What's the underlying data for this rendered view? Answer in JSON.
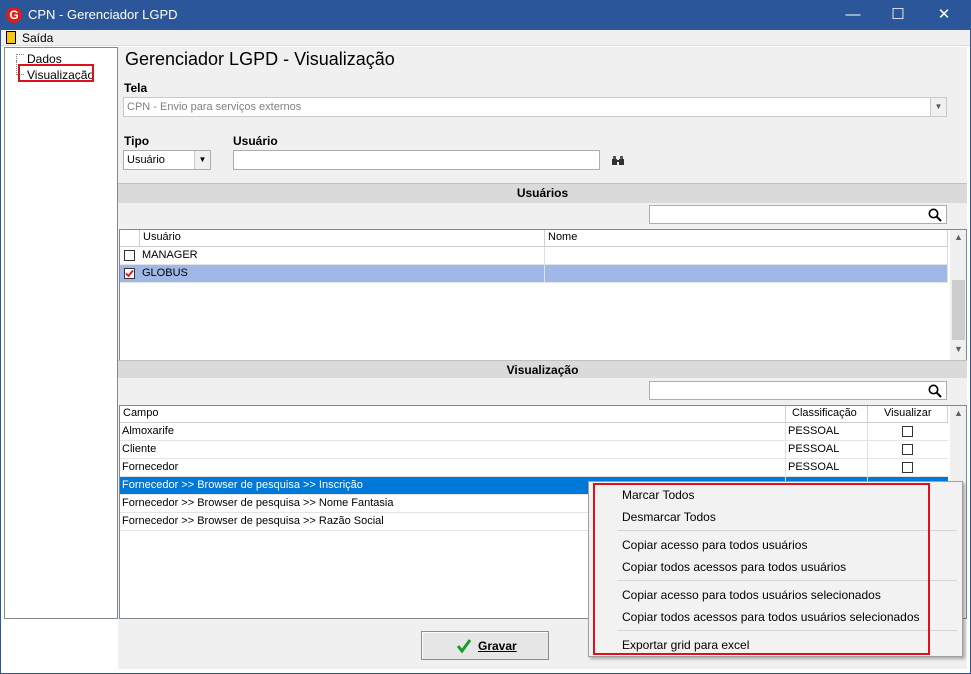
{
  "window": {
    "title": "CPN - Gerenciador LGPD",
    "logo_letter": "G"
  },
  "menubar": {
    "exit_label": "Saída"
  },
  "tree": {
    "items": [
      {
        "label": "Dados"
      },
      {
        "label": "Visualização"
      }
    ]
  },
  "header": {
    "title": "Gerenciador LGPD - Visualização"
  },
  "tela": {
    "label": "Tela",
    "value": "CPN - Envio para serviços externos"
  },
  "tipo": {
    "label": "Tipo",
    "value": "Usuário"
  },
  "usuario": {
    "label": "Usuário",
    "value": ""
  },
  "usuarios_section": {
    "title": "Usuários",
    "columns": [
      "Usuário",
      "Nome"
    ],
    "rows": [
      {
        "user": "MANAGER",
        "name": "",
        "checked": false
      },
      {
        "user": "GLOBUS",
        "name": "",
        "checked": true
      }
    ]
  },
  "visualizacao_section": {
    "title": "Visualização",
    "columns": [
      "Campo",
      "Classificação",
      "Visualizar"
    ],
    "rows": [
      {
        "campo": "Almoxarife",
        "classificacao": "PESSOAL"
      },
      {
        "campo": "Cliente",
        "classificacao": "PESSOAL"
      },
      {
        "campo": "Fornecedor",
        "classificacao": "PESSOAL"
      },
      {
        "campo": "Fornecedor >> Browser de pesquisa >> Inscrição",
        "classificacao": ""
      },
      {
        "campo": "Fornecedor >> Browser de pesquisa >> Nome Fantasia",
        "classificacao": ""
      },
      {
        "campo": "Fornecedor >> Browser de pesquisa >> Razão Social",
        "classificacao": ""
      }
    ]
  },
  "context_menu": {
    "items": [
      "Marcar Todos",
      "Desmarcar Todos",
      "Copiar acesso para todos usuários",
      "Copiar todos acessos para todos usuários",
      "Copiar acesso para todos usuários selecionados",
      "Copiar todos acessos para todos usuários selecionados",
      "Exportar grid para excel"
    ]
  },
  "buttons": {
    "save_label": "Gravar"
  },
  "colors": {
    "titlebar": "#2b579a",
    "selection": "#0078d7",
    "row_highlight": "#9fb8e8",
    "annotation": "#e0101a"
  }
}
